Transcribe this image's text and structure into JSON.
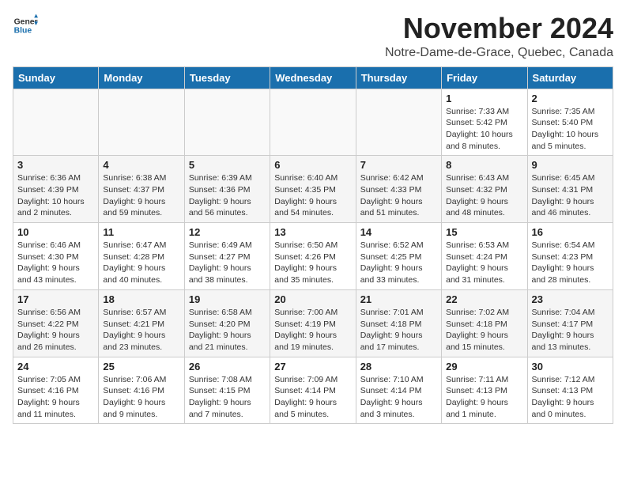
{
  "header": {
    "logo_line1": "General",
    "logo_line2": "Blue",
    "month": "November 2024",
    "location": "Notre-Dame-de-Grace, Quebec, Canada"
  },
  "weekdays": [
    "Sunday",
    "Monday",
    "Tuesday",
    "Wednesday",
    "Thursday",
    "Friday",
    "Saturday"
  ],
  "weeks": [
    [
      {
        "day": "",
        "info": ""
      },
      {
        "day": "",
        "info": ""
      },
      {
        "day": "",
        "info": ""
      },
      {
        "day": "",
        "info": ""
      },
      {
        "day": "",
        "info": ""
      },
      {
        "day": "1",
        "info": "Sunrise: 7:33 AM\nSunset: 5:42 PM\nDaylight: 10 hours and 8 minutes."
      },
      {
        "day": "2",
        "info": "Sunrise: 7:35 AM\nSunset: 5:40 PM\nDaylight: 10 hours and 5 minutes."
      }
    ],
    [
      {
        "day": "3",
        "info": "Sunrise: 6:36 AM\nSunset: 4:39 PM\nDaylight: 10 hours and 2 minutes."
      },
      {
        "day": "4",
        "info": "Sunrise: 6:38 AM\nSunset: 4:37 PM\nDaylight: 9 hours and 59 minutes."
      },
      {
        "day": "5",
        "info": "Sunrise: 6:39 AM\nSunset: 4:36 PM\nDaylight: 9 hours and 56 minutes."
      },
      {
        "day": "6",
        "info": "Sunrise: 6:40 AM\nSunset: 4:35 PM\nDaylight: 9 hours and 54 minutes."
      },
      {
        "day": "7",
        "info": "Sunrise: 6:42 AM\nSunset: 4:33 PM\nDaylight: 9 hours and 51 minutes."
      },
      {
        "day": "8",
        "info": "Sunrise: 6:43 AM\nSunset: 4:32 PM\nDaylight: 9 hours and 48 minutes."
      },
      {
        "day": "9",
        "info": "Sunrise: 6:45 AM\nSunset: 4:31 PM\nDaylight: 9 hours and 46 minutes."
      }
    ],
    [
      {
        "day": "10",
        "info": "Sunrise: 6:46 AM\nSunset: 4:30 PM\nDaylight: 9 hours and 43 minutes."
      },
      {
        "day": "11",
        "info": "Sunrise: 6:47 AM\nSunset: 4:28 PM\nDaylight: 9 hours and 40 minutes."
      },
      {
        "day": "12",
        "info": "Sunrise: 6:49 AM\nSunset: 4:27 PM\nDaylight: 9 hours and 38 minutes."
      },
      {
        "day": "13",
        "info": "Sunrise: 6:50 AM\nSunset: 4:26 PM\nDaylight: 9 hours and 35 minutes."
      },
      {
        "day": "14",
        "info": "Sunrise: 6:52 AM\nSunset: 4:25 PM\nDaylight: 9 hours and 33 minutes."
      },
      {
        "day": "15",
        "info": "Sunrise: 6:53 AM\nSunset: 4:24 PM\nDaylight: 9 hours and 31 minutes."
      },
      {
        "day": "16",
        "info": "Sunrise: 6:54 AM\nSunset: 4:23 PM\nDaylight: 9 hours and 28 minutes."
      }
    ],
    [
      {
        "day": "17",
        "info": "Sunrise: 6:56 AM\nSunset: 4:22 PM\nDaylight: 9 hours and 26 minutes."
      },
      {
        "day": "18",
        "info": "Sunrise: 6:57 AM\nSunset: 4:21 PM\nDaylight: 9 hours and 23 minutes."
      },
      {
        "day": "19",
        "info": "Sunrise: 6:58 AM\nSunset: 4:20 PM\nDaylight: 9 hours and 21 minutes."
      },
      {
        "day": "20",
        "info": "Sunrise: 7:00 AM\nSunset: 4:19 PM\nDaylight: 9 hours and 19 minutes."
      },
      {
        "day": "21",
        "info": "Sunrise: 7:01 AM\nSunset: 4:18 PM\nDaylight: 9 hours and 17 minutes."
      },
      {
        "day": "22",
        "info": "Sunrise: 7:02 AM\nSunset: 4:18 PM\nDaylight: 9 hours and 15 minutes."
      },
      {
        "day": "23",
        "info": "Sunrise: 7:04 AM\nSunset: 4:17 PM\nDaylight: 9 hours and 13 minutes."
      }
    ],
    [
      {
        "day": "24",
        "info": "Sunrise: 7:05 AM\nSunset: 4:16 PM\nDaylight: 9 hours and 11 minutes."
      },
      {
        "day": "25",
        "info": "Sunrise: 7:06 AM\nSunset: 4:16 PM\nDaylight: 9 hours and 9 minutes."
      },
      {
        "day": "26",
        "info": "Sunrise: 7:08 AM\nSunset: 4:15 PM\nDaylight: 9 hours and 7 minutes."
      },
      {
        "day": "27",
        "info": "Sunrise: 7:09 AM\nSunset: 4:14 PM\nDaylight: 9 hours and 5 minutes."
      },
      {
        "day": "28",
        "info": "Sunrise: 7:10 AM\nSunset: 4:14 PM\nDaylight: 9 hours and 3 minutes."
      },
      {
        "day": "29",
        "info": "Sunrise: 7:11 AM\nSunset: 4:13 PM\nDaylight: 9 hours and 1 minute."
      },
      {
        "day": "30",
        "info": "Sunrise: 7:12 AM\nSunset: 4:13 PM\nDaylight: 9 hours and 0 minutes."
      }
    ]
  ]
}
